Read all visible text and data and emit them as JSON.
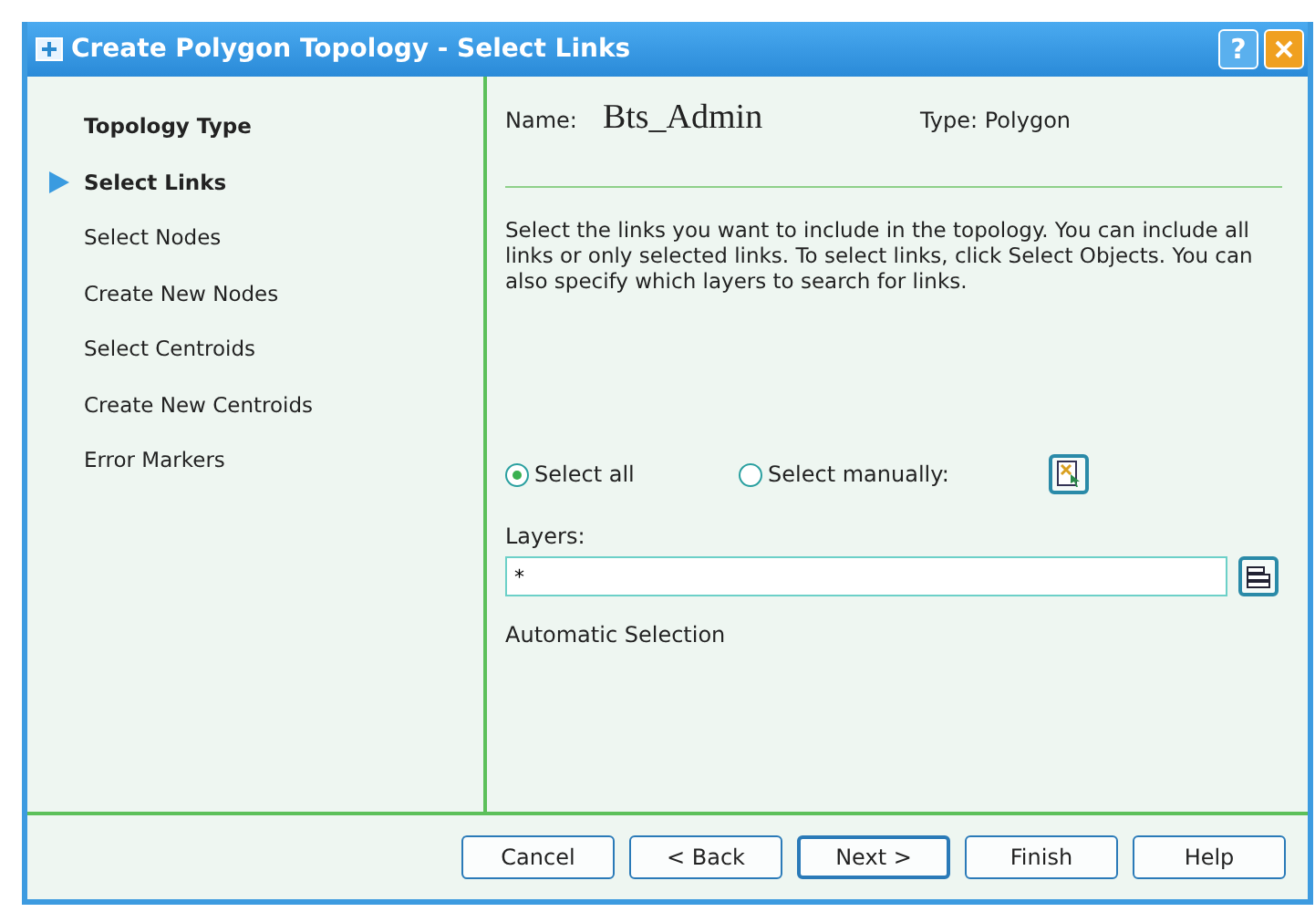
{
  "window": {
    "title": "Create Polygon Topology - Select Links",
    "help_button": "?"
  },
  "steps": [
    {
      "label": "Topology Type",
      "selected": false,
      "visited": true
    },
    {
      "label": "Select Links",
      "selected": true,
      "visited": true
    },
    {
      "label": "Select Nodes",
      "selected": false,
      "visited": false
    },
    {
      "label": "Create New Nodes",
      "selected": false,
      "visited": false
    },
    {
      "label": "Select Centroids",
      "selected": false,
      "visited": false
    },
    {
      "label": "Create New Centroids",
      "selected": false,
      "visited": false
    },
    {
      "label": "Error Markers",
      "selected": false,
      "visited": false
    }
  ],
  "header": {
    "name_label": "Name:",
    "name_value": "Bts_Admin",
    "type_label": "Type: Polygon"
  },
  "description": "Select the links you want to include in the topology. You can include all links or only selected links. To select links, click Select Objects. You can also specify which layers to search for links.",
  "options": [
    {
      "label": "Select all",
      "selected": true
    },
    {
      "label": "Select manually:",
      "selected": false
    }
  ],
  "layers": {
    "label": "Layers:",
    "value": "*"
  },
  "automatic_selection": "Automatic Selection",
  "buttons": [
    {
      "label": "Cancel",
      "default": false
    },
    {
      "label": "< Back",
      "default": false
    },
    {
      "label": "Next >",
      "default": true
    },
    {
      "label": "Finish",
      "default": false
    },
    {
      "label": "Help",
      "default": false
    }
  ]
}
